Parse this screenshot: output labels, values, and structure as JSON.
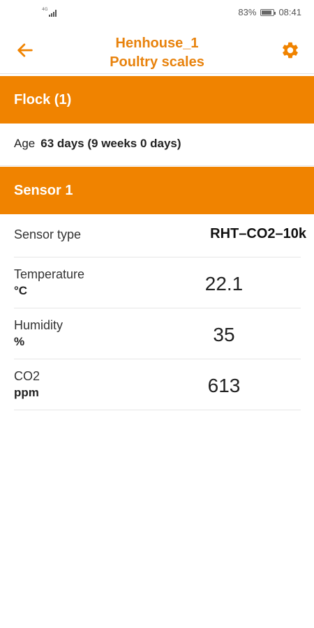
{
  "status_bar": {
    "network_label": "4G",
    "battery_percent": "83%",
    "battery_level": 0.83,
    "time": "08:41"
  },
  "app_bar": {
    "title_line1": "Henhouse_1",
    "title_line2": "Poultry scales",
    "accent_color": "#f08300",
    "back_icon": "arrow-left-icon",
    "settings_icon": "gear-icon"
  },
  "flock": {
    "header": "Flock (1)",
    "age_label": "Age",
    "age_value": "63 days (9 weeks 0 days)"
  },
  "sensor": {
    "header": "Sensor 1",
    "type_label": "Sensor type",
    "type_value": "RHT–CO2–10k",
    "readings": [
      {
        "label": "Temperature",
        "unit": "°C",
        "value": "22.1"
      },
      {
        "label": "Humidity",
        "unit": "%",
        "value": "35"
      },
      {
        "label": "CO2",
        "unit": "ppm",
        "value": "613"
      }
    ]
  }
}
